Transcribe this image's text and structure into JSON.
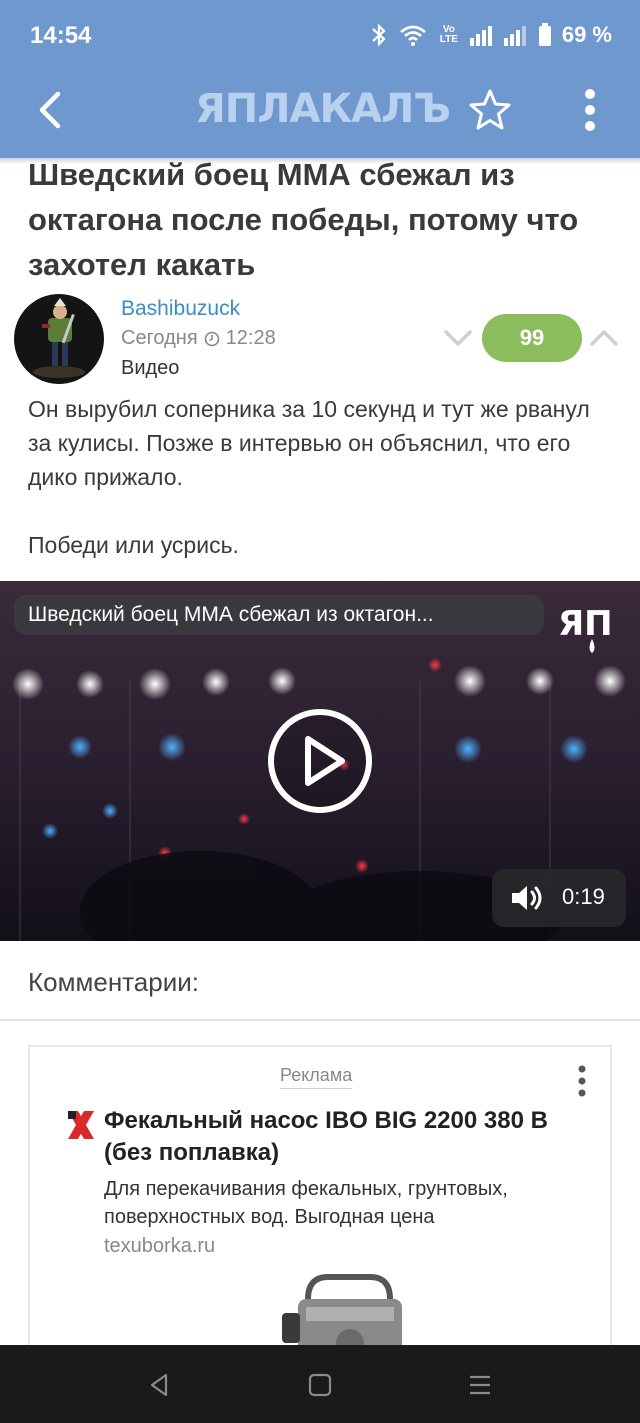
{
  "status_bar": {
    "time": "14:54",
    "network_label": "Vo LTE",
    "battery": "69 %"
  },
  "app_bar": {
    "logo_text": "ЯПЛАКАЛЪ"
  },
  "post": {
    "title": "Шведский боец ММА сбежал из октагона после победы, потому что захотел какать",
    "author": "Bashibuzuck",
    "date_label": "Сегодня",
    "time": "12:28",
    "category": "Видео",
    "rating": "99",
    "body_lines": [
      "Он вырубил соперника за 10 секунд и тут же рванул за кулисы. Позже в интервью он объяснил, что его дико прижало.",
      "Победи или усрись."
    ]
  },
  "video": {
    "title": "Шведский боец ММА сбежал из октагон...",
    "logo_text": "ЯП",
    "duration": "0:19"
  },
  "comments": {
    "heading": "Комментарии:"
  },
  "ad": {
    "label": "Реклама",
    "title": "Фекальный насос IBO BIG 2200 380 В (без поплавка)",
    "description": "Для перекачивания фекальных, грунтовых, поверхностных вод. Выгодная цена",
    "domain": "texuborka.ru"
  },
  "colors": {
    "app_bar": "#6f98cf",
    "author_link": "#3a8dc4",
    "rating_badge": "#8bbd5c",
    "nav_bar": "#1a1a1a"
  }
}
